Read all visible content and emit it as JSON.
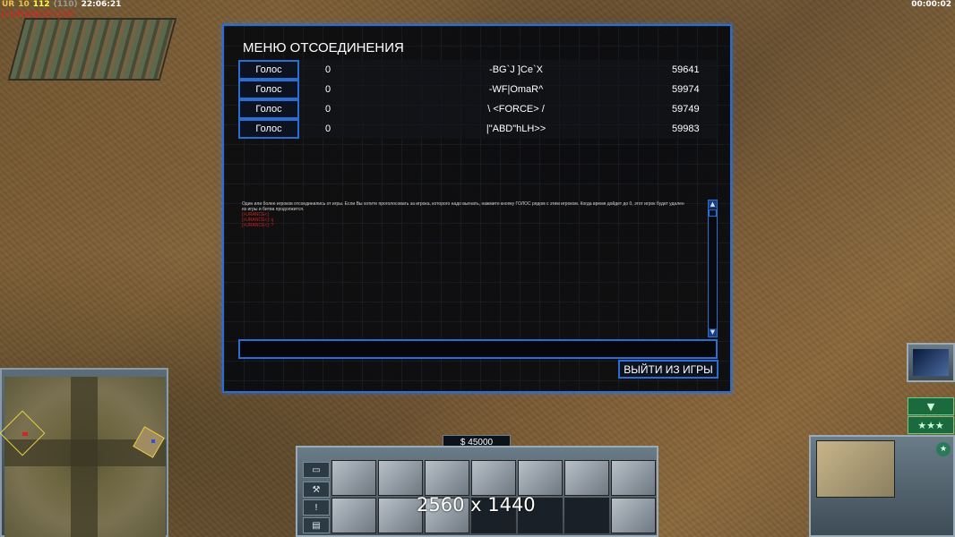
{
  "hud": {
    "ur_label": "UR",
    "ur_value": "10",
    "fps": "112",
    "fps_paren": "(110)",
    "clock": "22:06:21",
    "player_tag": "[>URANCE<] lol",
    "game_timer": "00:00:02"
  },
  "dialog": {
    "title": "МЕНЮ ОТСОЕДИНЕНИЯ",
    "players": [
      {
        "vote_label": "Голос",
        "votes": "0",
        "name": "-BG`J ]Ce`X",
        "ping": "59641"
      },
      {
        "vote_label": "Голос",
        "votes": "0",
        "name": "-WF|OmaR^",
        "ping": "59974"
      },
      {
        "vote_label": "Голос",
        "votes": "0",
        "name": "\\ <FORCE> /",
        "ping": "59749"
      },
      {
        "vote_label": "Голос",
        "votes": "0",
        "name": "|\"ABD\"hLH>>",
        "ping": "59983"
      }
    ],
    "log_message": "Один или более игроков отсоединились от игры. Если Вы хотите проголосовать за игрока, которого надо выгнать, нажмите кнопку ГОЛОС рядом с этим игроком. Когда время дойдет до 0, этот игрок будет удален из игры и битва продолжится.",
    "log_lines": [
      "[>URANCE<]",
      "[>URANCE<]: q",
      "[>URANCE<]: ?"
    ],
    "exit_label": "ВЫЙТИ ИЗ ИГРЫ"
  },
  "money": "$ 45000",
  "overlay_text": "2560 x 1440",
  "colors": {
    "accent": "#2a6ed4",
    "player_red": "#e02020",
    "hud_yellow": "#ffff40"
  }
}
